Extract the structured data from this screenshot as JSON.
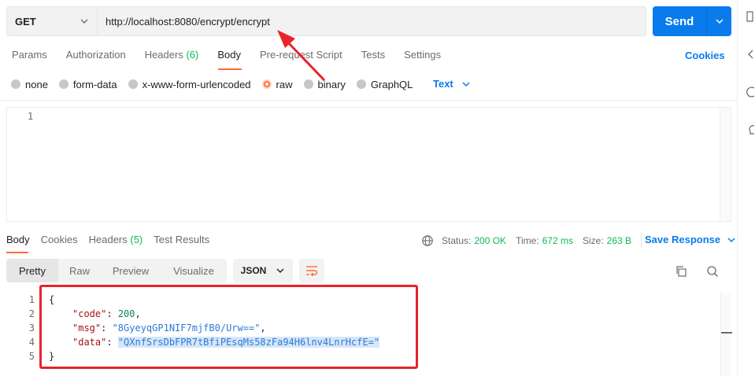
{
  "request": {
    "method": "GET",
    "url": "http://localhost:8080/encrypt/encrypt",
    "send_label": "Send"
  },
  "request_tabs": [
    {
      "label": "Params",
      "count": ""
    },
    {
      "label": "Authorization",
      "count": ""
    },
    {
      "label": "Headers",
      "count": "(6)"
    },
    {
      "label": "Body",
      "count": ""
    },
    {
      "label": "Pre-request Script",
      "count": ""
    },
    {
      "label": "Tests",
      "count": ""
    },
    {
      "label": "Settings",
      "count": ""
    }
  ],
  "cookies_label": "Cookies",
  "body_types": [
    "none",
    "form-data",
    "x-www-form-urlencoded",
    "raw",
    "binary",
    "GraphQL"
  ],
  "body_format": "Text",
  "request_editor": {
    "line_numbers": [
      "1"
    ]
  },
  "response_tabs": [
    {
      "label": "Body",
      "count": ""
    },
    {
      "label": "Cookies",
      "count": ""
    },
    {
      "label": "Headers",
      "count": "(5)"
    },
    {
      "label": "Test Results",
      "count": ""
    }
  ],
  "response_status": {
    "status_label": "Status:",
    "status_value": "200 OK",
    "time_label": "Time:",
    "time_value": "672 ms",
    "size_label": "Size:",
    "size_value": "263 B"
  },
  "save_response_label": "Save Response",
  "view_modes": [
    "Pretty",
    "Raw",
    "Preview",
    "Visualize"
  ],
  "response_format": "JSON",
  "response_code": {
    "line_numbers": [
      "1",
      "2",
      "3",
      "4",
      "5"
    ],
    "open_brace": "{",
    "close_brace": "}",
    "code_key": "\"code\"",
    "code_value": "200",
    "msg_key": "\"msg\"",
    "msg_value": "\"8GyeyqGP1NIF7mjfB0/Urw==\"",
    "data_key": "\"data\"",
    "data_value": "\"QXnfSrsDbFPR7tBfiPEsqMs58zFa94H6lnv4LnrHcfE=\"",
    "colon": ": ",
    "comma": ","
  },
  "colors": {
    "accent": "#ff6c37",
    "primary": "#097bed",
    "success": "#0cbb52",
    "annotation": "#e8232a"
  }
}
